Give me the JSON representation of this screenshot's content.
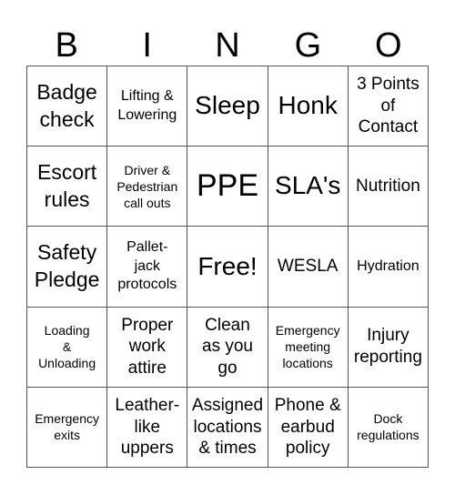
{
  "header": [
    "B",
    "I",
    "N",
    "G",
    "O"
  ],
  "cells": [
    {
      "text": "Badge\ncheck",
      "size": "s4"
    },
    {
      "text": "Lifting &\nLowering",
      "size": "s2"
    },
    {
      "text": "Sleep",
      "size": "s5"
    },
    {
      "text": "Honk",
      "size": "s5"
    },
    {
      "text": "3 Points\nof\nContact",
      "size": "s3"
    },
    {
      "text": "Escort\nrules",
      "size": "s4"
    },
    {
      "text": "Driver &\nPedestrian\ncall outs",
      "size": "s1"
    },
    {
      "text": "PPE",
      "size": "s6"
    },
    {
      "text": "SLA's",
      "size": "s5"
    },
    {
      "text": "Nutrition",
      "size": "s3"
    },
    {
      "text": "Safety\nPledge",
      "size": "s4"
    },
    {
      "text": "Pallet-\njack\nprotocols",
      "size": "s2"
    },
    {
      "text": "Free!",
      "size": "s5"
    },
    {
      "text": "WESLA",
      "size": "s3"
    },
    {
      "text": "Hydration",
      "size": "s2"
    },
    {
      "text": "Loading\n&\nUnloading",
      "size": "s1"
    },
    {
      "text": "Proper\nwork\nattire",
      "size": "s3"
    },
    {
      "text": "Clean\nas you\ngo",
      "size": "s3"
    },
    {
      "text": "Emergency\nmeeting\nlocations",
      "size": "s1"
    },
    {
      "text": "Injury\nreporting",
      "size": "s3"
    },
    {
      "text": "Emergency\nexits",
      "size": "s1"
    },
    {
      "text": "Leather-\nlike\nuppers",
      "size": "s3"
    },
    {
      "text": "Assigned\nlocations\n& times",
      "size": "s3"
    },
    {
      "text": "Phone &\nearbud\npolicy",
      "size": "s3"
    },
    {
      "text": "Dock\nregulations",
      "size": "s1"
    }
  ]
}
